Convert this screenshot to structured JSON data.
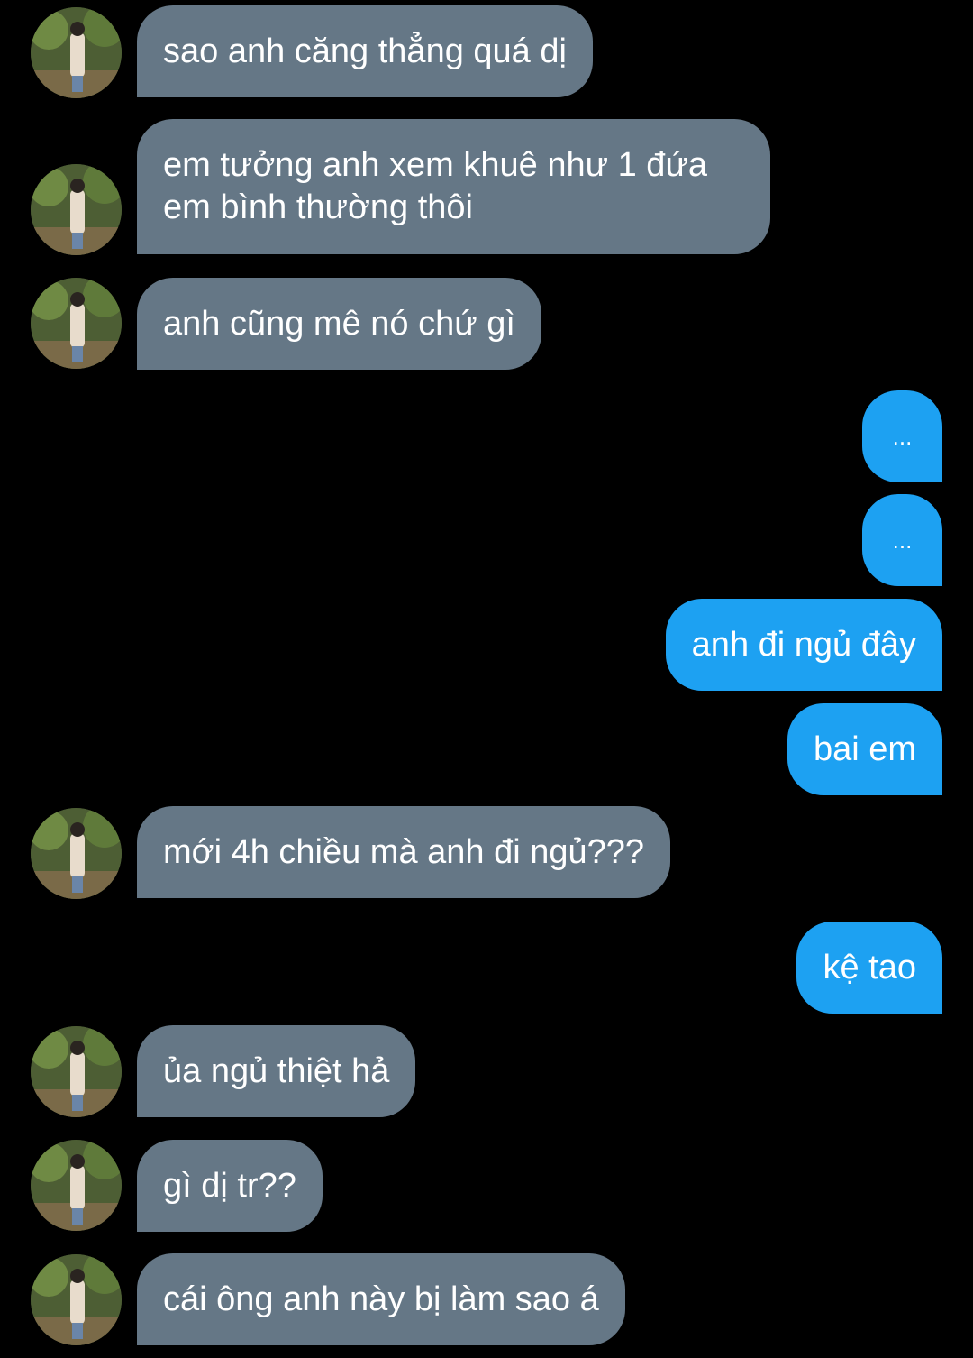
{
  "colors": {
    "background": "#000000",
    "incoming_bubble": "#657786",
    "outgoing_bubble": "#1da1f2",
    "text": "#ffffff"
  },
  "contact": {
    "avatar_icon": "profile-photo-avatar"
  },
  "messages": [
    {
      "direction": "in",
      "text": "sao anh căng thẳng quá dị"
    },
    {
      "direction": "in",
      "line1": "em tưởng anh xem khuê như 1 đứa",
      "line2": "em bình thường thôi"
    },
    {
      "direction": "in",
      "text": "anh cũng mê nó chứ gì"
    },
    {
      "direction": "out",
      "text": "..."
    },
    {
      "direction": "out",
      "text": "..."
    },
    {
      "direction": "out",
      "text": "anh đi ngủ đây"
    },
    {
      "direction": "out",
      "text": "bai em"
    },
    {
      "direction": "in",
      "text": "mới 4h chiều mà anh đi ngủ???"
    },
    {
      "direction": "out",
      "text": "kệ tao"
    },
    {
      "direction": "in",
      "text": "ủa ngủ thiệt hả"
    },
    {
      "direction": "in",
      "text": "gì dị tr??"
    },
    {
      "direction": "in",
      "text": "cái ông anh này bị làm sao á"
    }
  ]
}
